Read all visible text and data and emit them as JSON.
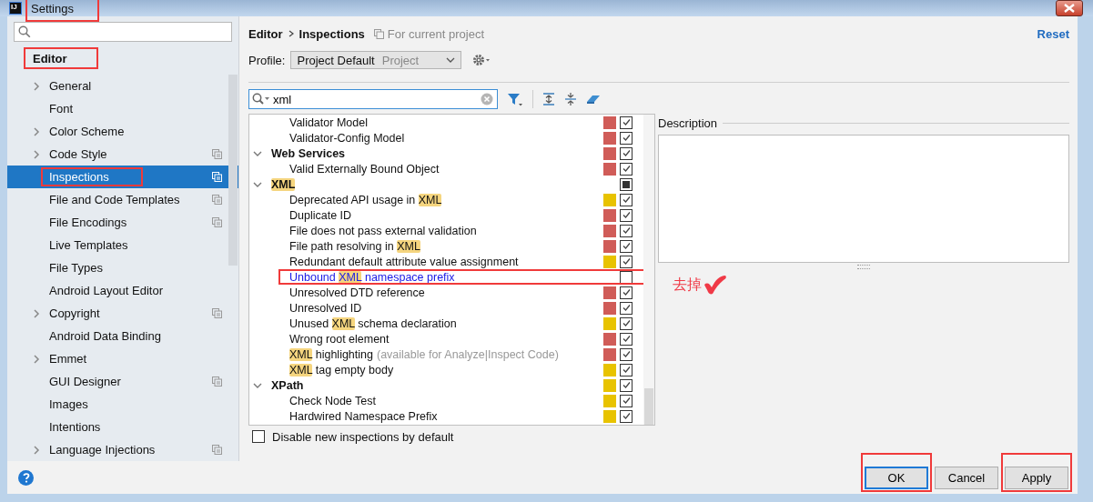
{
  "window": {
    "app_icon_text": "IJ",
    "title": "Settings",
    "title_marked": true
  },
  "sidebar": {
    "section": {
      "label": "Editor",
      "marked": true
    },
    "items": [
      {
        "label": "General",
        "expandable": true,
        "project_icon": false,
        "selected": false,
        "marked": false
      },
      {
        "label": "Font",
        "expandable": false,
        "project_icon": false,
        "selected": false,
        "marked": false
      },
      {
        "label": "Color Scheme",
        "expandable": true,
        "project_icon": false,
        "selected": false,
        "marked": false
      },
      {
        "label": "Code Style",
        "expandable": true,
        "project_icon": true,
        "selected": false,
        "marked": false
      },
      {
        "label": "Inspections",
        "expandable": false,
        "project_icon": true,
        "selected": true,
        "marked": true
      },
      {
        "label": "File and Code Templates",
        "expandable": false,
        "project_icon": true,
        "selected": false,
        "marked": false
      },
      {
        "label": "File Encodings",
        "expandable": false,
        "project_icon": true,
        "selected": false,
        "marked": false
      },
      {
        "label": "Live Templates",
        "expandable": false,
        "project_icon": false,
        "selected": false,
        "marked": false
      },
      {
        "label": "File Types",
        "expandable": false,
        "project_icon": false,
        "selected": false,
        "marked": false
      },
      {
        "label": "Android Layout Editor",
        "expandable": false,
        "project_icon": false,
        "selected": false,
        "marked": false
      },
      {
        "label": "Copyright",
        "expandable": true,
        "project_icon": true,
        "selected": false,
        "marked": false
      },
      {
        "label": "Android Data Binding",
        "expandable": false,
        "project_icon": false,
        "selected": false,
        "marked": false
      },
      {
        "label": "Emmet",
        "expandable": true,
        "project_icon": false,
        "selected": false,
        "marked": false
      },
      {
        "label": "GUI Designer",
        "expandable": false,
        "project_icon": true,
        "selected": false,
        "marked": false
      },
      {
        "label": "Images",
        "expandable": false,
        "project_icon": false,
        "selected": false,
        "marked": false
      },
      {
        "label": "Intentions",
        "expandable": false,
        "project_icon": false,
        "selected": false,
        "marked": false
      },
      {
        "label": "Language Injections",
        "expandable": true,
        "project_icon": true,
        "selected": false,
        "marked": false
      }
    ]
  },
  "breadcrumb": [
    "Editor",
    "Inspections"
  ],
  "scope_note": "For current project",
  "reset_link": "Reset",
  "profile": {
    "label": "Profile:",
    "value": "Project Default",
    "scope": "Project"
  },
  "filter": {
    "value": "xml"
  },
  "tree": [
    {
      "kind": "partial-group",
      "children": [
        {
          "kind": "item",
          "parts": [
            {
              "text": "Validator Model",
              "match": false
            }
          ],
          "color": "#d05c58",
          "checked": true,
          "changed": false,
          "marked": false
        },
        {
          "kind": "item",
          "parts": [
            {
              "text": "Validator-Config Model",
              "match": false
            }
          ],
          "color": "#d05c58",
          "checked": true,
          "changed": false,
          "marked": false
        }
      ]
    },
    {
      "kind": "group",
      "parts": [
        {
          "text": "Web Services",
          "match": false
        }
      ],
      "expanded": true,
      "color": "#d05c58",
      "checked": true,
      "children": [
        {
          "kind": "item",
          "parts": [
            {
              "text": "Valid Externally Bound Object",
              "match": false
            }
          ],
          "color": "#d05c58",
          "checked": true,
          "changed": false,
          "marked": false
        }
      ]
    },
    {
      "kind": "group",
      "parts": [
        {
          "text": "XML",
          "match": true
        }
      ],
      "expanded": true,
      "partial": true,
      "children": [
        {
          "kind": "item",
          "parts": [
            {
              "text": "Deprecated API usage in ",
              "match": false
            },
            {
              "text": "XML",
              "match": true
            }
          ],
          "color": "#e8c300",
          "checked": true,
          "changed": false,
          "marked": false
        },
        {
          "kind": "item",
          "parts": [
            {
              "text": "Duplicate ID",
              "match": false
            }
          ],
          "color": "#d05c58",
          "checked": true,
          "changed": false,
          "marked": false
        },
        {
          "kind": "item",
          "parts": [
            {
              "text": "File does not pass external validation",
              "match": false
            }
          ],
          "color": "#d05c58",
          "checked": true,
          "changed": false,
          "marked": false
        },
        {
          "kind": "item",
          "parts": [
            {
              "text": "File path resolving in ",
              "match": false
            },
            {
              "text": "XML",
              "match": true
            }
          ],
          "color": "#d05c58",
          "checked": true,
          "changed": false,
          "marked": false
        },
        {
          "kind": "item",
          "parts": [
            {
              "text": "Redundant default attribute value assignment",
              "match": false
            }
          ],
          "color": "#e8c300",
          "checked": true,
          "changed": false,
          "marked": false
        },
        {
          "kind": "item",
          "parts": [
            {
              "text": "Unbound ",
              "match": false
            },
            {
              "text": "XML",
              "match": true
            },
            {
              "text": " namespace prefix",
              "match": false
            }
          ],
          "checked": false,
          "changed": true,
          "marked": true
        },
        {
          "kind": "item",
          "parts": [
            {
              "text": "Unresolved DTD reference",
              "match": false
            }
          ],
          "color": "#d05c58",
          "checked": true,
          "changed": false,
          "marked": false
        },
        {
          "kind": "item",
          "parts": [
            {
              "text": "Unresolved ID",
              "match": false
            }
          ],
          "color": "#d05c58",
          "checked": true,
          "changed": false,
          "marked": false
        },
        {
          "kind": "item",
          "parts": [
            {
              "text": "Unused ",
              "match": false
            },
            {
              "text": "XML",
              "match": true
            },
            {
              "text": " schema declaration",
              "match": false
            }
          ],
          "color": "#e8c300",
          "checked": true,
          "changed": false,
          "marked": false
        },
        {
          "kind": "item",
          "parts": [
            {
              "text": "Wrong root element",
              "match": false
            }
          ],
          "color": "#d05c58",
          "checked": true,
          "changed": false,
          "marked": false
        },
        {
          "kind": "item",
          "parts": [
            {
              "text": "XML",
              "match": true
            },
            {
              "text": " highlighting",
              "match": false
            }
          ],
          "hint": "(available for Analyze|Inspect Code)",
          "color": "#d05c58",
          "checked": true,
          "changed": false,
          "marked": false
        },
        {
          "kind": "item",
          "parts": [
            {
              "text": "XML",
              "match": true
            },
            {
              "text": " tag empty body",
              "match": false
            }
          ],
          "color": "#e8c300",
          "checked": true,
          "changed": false,
          "marked": false
        }
      ]
    },
    {
      "kind": "group",
      "parts": [
        {
          "text": "XPath",
          "match": false
        }
      ],
      "expanded": true,
      "color": "#e8c300",
      "checked": true,
      "children": [
        {
          "kind": "item",
          "parts": [
            {
              "text": "Check Node Test",
              "match": false
            }
          ],
          "color": "#e8c300",
          "checked": true,
          "changed": false,
          "marked": false
        },
        {
          "kind": "item",
          "parts": [
            {
              "text": "Hardwired Namespace Prefix",
              "match": false
            }
          ],
          "color": "#e8c300",
          "checked": true,
          "changed": false,
          "marked": false
        }
      ]
    }
  ],
  "disable_new": {
    "label": "Disable new inspections by default",
    "checked": false
  },
  "description": {
    "label": "Description"
  },
  "annotation": {
    "text": "去掉"
  },
  "buttons": [
    {
      "label": "OK",
      "default": true,
      "marked": true
    },
    {
      "label": "Cancel",
      "default": false,
      "marked": false
    },
    {
      "label": "Apply",
      "default": false,
      "marked": true
    }
  ]
}
